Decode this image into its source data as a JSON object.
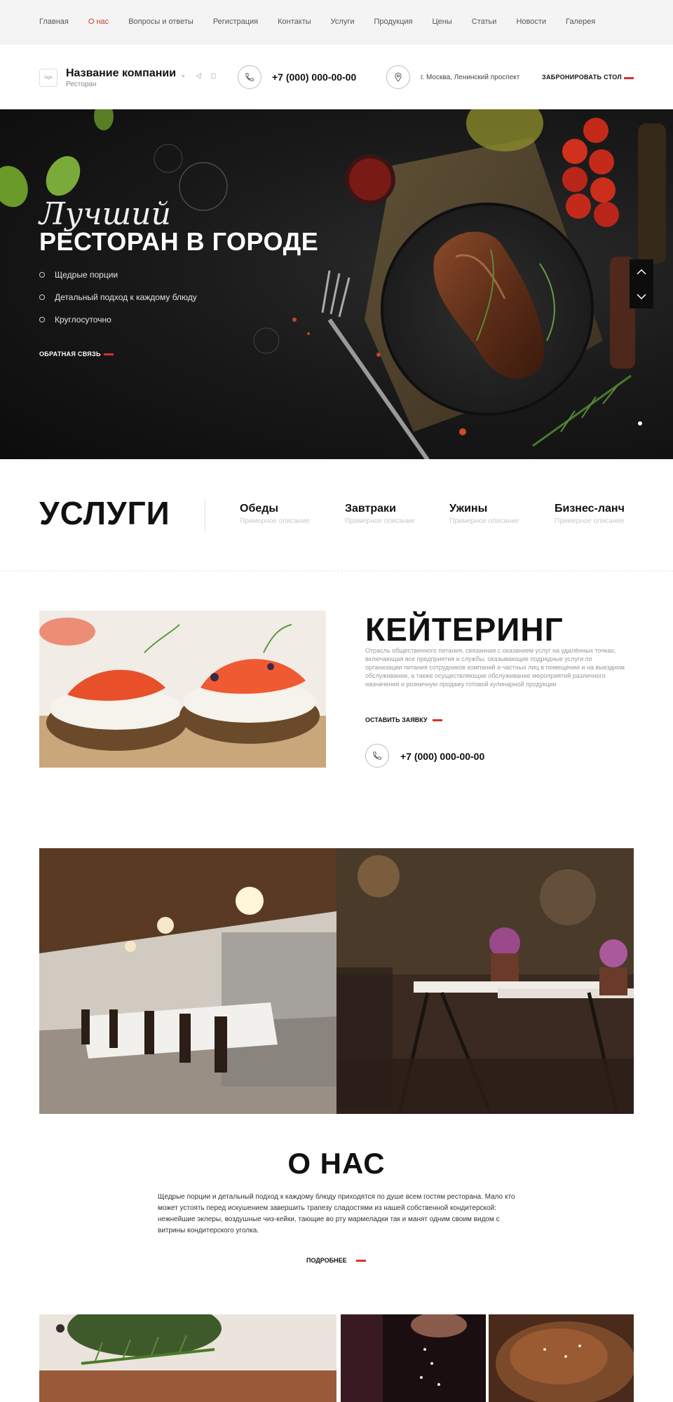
{
  "topnav": {
    "items": [
      {
        "label": "Главная",
        "active": false
      },
      {
        "label": "О нас",
        "active": true
      },
      {
        "label": "Вопросы и ответы",
        "active": false
      },
      {
        "label": "Регистрация",
        "active": false
      },
      {
        "label": "Контакты",
        "active": false
      },
      {
        "label": "Услуги",
        "active": false
      },
      {
        "label": "Продукция",
        "active": false
      },
      {
        "label": "Цены",
        "active": false
      },
      {
        "label": "Статьи",
        "active": false
      },
      {
        "label": "Новости",
        "active": false
      },
      {
        "label": "Галерея",
        "active": false
      }
    ]
  },
  "header": {
    "logo_text": "logo",
    "company_name": "Название компании",
    "company_sub": "Ресторан",
    "socials": [
      "vk-icon",
      "telegram-icon",
      "viber-icon"
    ],
    "phone": "+7 (000) 000-00-00",
    "address": "г. Москва, Ленинский проспект",
    "book_label": "ЗАБРОНИРОВАТЬ СТОЛ"
  },
  "hero": {
    "script_title": "Лучший",
    "title": "РЕСТОРАН В ГОРОДЕ",
    "bullets": [
      "Щедрые порции",
      "Детальный подход к каждому блюду",
      "Круглосуточно"
    ],
    "cta_label": "ОБРАТНАЯ СВЯЗЬ",
    "arrow_up": "up-chevron-icon",
    "arrow_down": "down-chevron-icon"
  },
  "services": {
    "title": "УСЛУГИ",
    "items": [
      {
        "name": "Обеды",
        "desc": "Примерное описание"
      },
      {
        "name": "Завтраки",
        "desc": "Примерное описание"
      },
      {
        "name": "Ужины",
        "desc": "Примерное описание"
      },
      {
        "name": "Бизнес-ланч",
        "desc": "Примерное описание"
      }
    ]
  },
  "catering": {
    "title": "КЕЙТЕРИНГ",
    "text": "Отрасль общественного питания, связанная с оказанием услуг на удалённых точках, включающая все предприятия и службы, оказывающие подрядные услуги по организации питания сотрудников компаний и частных лиц в помещении и на выездном обслуживании, а также осуществляющие обслуживание мероприятий различного назначения и розничную продажу готовой кулинарной продукции",
    "cta_label": "ОСТАВИТЬ ЗАЯВКУ",
    "phone": "+7 (000) 000-00-00"
  },
  "about": {
    "title": "О НАС",
    "text": "Щедрые порции и детальный подход к каждому блюду приходятся по душе всем гостям ресторана. Мало кто может устоять перед искушением завершить трапезу сладостями из нашей собственной кондитерской: нежнейшие эклеры, воздушные чиз-кейки, тающие во рту мармеладки так и манят одним своим видом с витрины кондитерского уголка.",
    "cta_label": "ПОДРОБНЕЕ"
  },
  "colors": {
    "accent": "#d6322a",
    "nav_active": "#c73a33",
    "topnav_bg": "#f4f4f4",
    "hero_bg": "#141414"
  }
}
